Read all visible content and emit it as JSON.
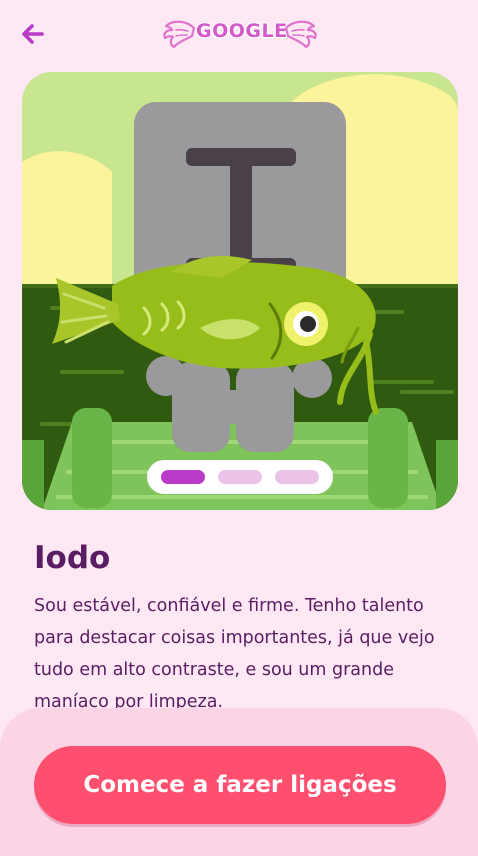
{
  "header": {
    "back_label": "Voltar",
    "logo_text": "GOOGLE"
  },
  "card": {
    "illustration": "fish-with-letter-I",
    "carousel": {
      "count": 3,
      "active": 0
    }
  },
  "character": {
    "name": "Iodo",
    "description": "Sou estável, confiável e firme. Tenho talento para destacar coisas importantes, já que vejo tudo em alto contraste, e sou um grande maníaco por limpeza."
  },
  "footer": {
    "cta_label": "Comece a fazer ligações"
  },
  "colors": {
    "background": "#fde8f3",
    "title": "#5a1c63",
    "accent": "#b93bc8",
    "cta": "#ff4f6e",
    "footer": "#fbd5e6"
  }
}
